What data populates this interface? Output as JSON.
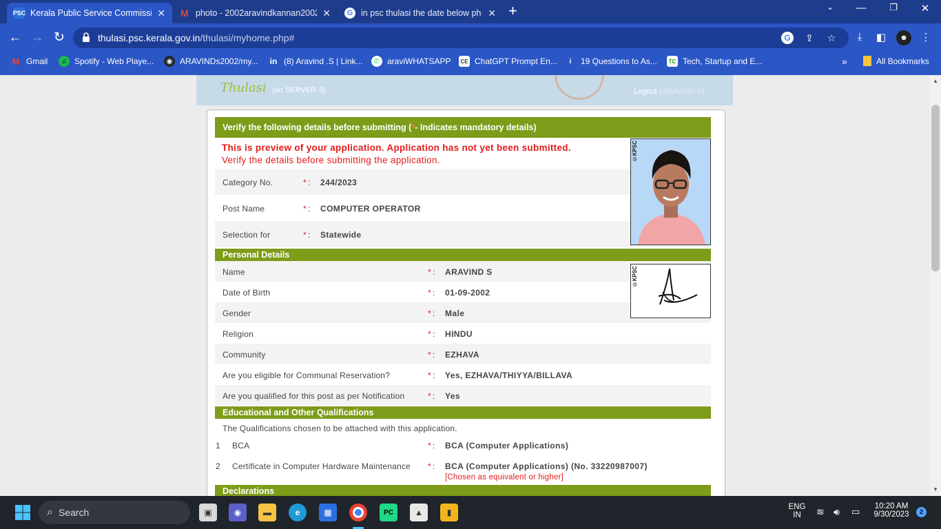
{
  "browser": {
    "tabs": [
      {
        "title": "Kerala Public Service Commissio",
        "active": true,
        "favicon": "psc-icon",
        "favicon_text": "PSC"
      },
      {
        "title": "photo - 2002aravindkannan2002",
        "active": false,
        "favicon": "gmail-icon",
        "favicon_text": "M"
      },
      {
        "title": "in psc thulasi the date below ph",
        "active": false,
        "favicon": "google-icon",
        "favicon_text": "G"
      }
    ],
    "url_host": "thulasi.psc.kerala.gov.in",
    "url_path": "/thulasi/myhome.php#",
    "bookmarks": [
      {
        "label": "Gmail",
        "icon": "gmail-icon",
        "glyph": "M",
        "color": "#ea4335"
      },
      {
        "label": "Spotify - Web Playe...",
        "icon": "spotify-icon",
        "glyph": "♫",
        "color": "#1db954"
      },
      {
        "label": "ARAVINDs2002/my...",
        "icon": "github-icon",
        "glyph": "◉",
        "color": "#24292e"
      },
      {
        "label": "(8) Aravind .S | Link...",
        "icon": "linkedin-icon",
        "glyph": "in",
        "color": "#2a56c6"
      },
      {
        "label": "araviWHATSAPP",
        "icon": "whatsapp-icon",
        "glyph": "✆",
        "color": "#25d366"
      },
      {
        "label": "ChatGPT Prompt En...",
        "icon": "chatgpt-icon",
        "glyph": "CE",
        "color": "#333333"
      },
      {
        "label": "19 Questions to As...",
        "icon": "question-icon",
        "glyph": "i",
        "color": "#2a56c6"
      },
      {
        "label": "Tech, Startup and E...",
        "icon": "techcrunch-icon",
        "glyph": "TC",
        "color": "#0a9e01"
      }
    ],
    "all_bookmarks": "All Bookmarks"
  },
  "site": {
    "logo_text": "Thulasi",
    "server": "(on SERVER-3)",
    "logout": "Logout",
    "user": "(ARAVIND S)"
  },
  "form": {
    "header_prefix": "Verify the following details before submitting (",
    "header_star": "*",
    "header_suffix": " - Indicates mandatory details)",
    "preview_msg": "This is preview of your application. Application has not yet been submitted.",
    "verify_msg": "Verify the details before submitting the application.",
    "top_fields": [
      {
        "label": "Category No.",
        "value": "244/2023"
      },
      {
        "label": "Post Name",
        "value": "COMPUTER OPERATOR"
      },
      {
        "label": "Selection for",
        "value": "Statewide"
      }
    ],
    "personal_title": "Personal Details",
    "personal_fields": [
      {
        "label": "Name",
        "value": "ARAVIND S"
      },
      {
        "label": "Date of Birth",
        "value": "01-09-2002"
      },
      {
        "label": "Gender",
        "value": "Male"
      },
      {
        "label": "Religion",
        "value": "HINDU"
      },
      {
        "label": "Community",
        "value": "EZHAVA"
      },
      {
        "label": "Are you eligible for Communal Reservation?",
        "value": "Yes, EZHAVA/THIYYA/BILLAVA"
      },
      {
        "label": "Are you qualified for this post as per Notification",
        "value": "Yes"
      }
    ],
    "edu_title": "Educational and Other Qualifications",
    "edu_note": "The Qualifications chosen to be attached with this application.",
    "qualifications": [
      {
        "num": "1",
        "label": "BCA",
        "value": "BCA (Computer Applications)",
        "note": ""
      },
      {
        "num": "2",
        "label": "Certificate in Computer Hardware Maintenance",
        "value": "BCA (Computer Applications) (No. 33220987007)",
        "note": "[Chosen as equivalent or higher]"
      }
    ],
    "declarations_title": "Declarations",
    "mark": "*",
    "colon": ":",
    "photo_tag": "©KPSC",
    "sign_tag": "©KPSC"
  },
  "taskbar": {
    "search_placeholder": "Search",
    "lang_top": "ENG",
    "lang_bottom": "IN",
    "time": "10:20 AM",
    "date": "9/30/2023",
    "notifications": "2"
  }
}
